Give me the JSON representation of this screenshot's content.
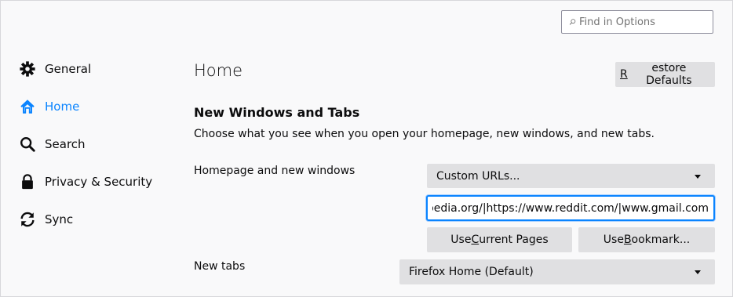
{
  "search": {
    "placeholder": "Find in Options"
  },
  "sidebar": {
    "items": [
      {
        "label": "General",
        "icon": "gear-icon"
      },
      {
        "label": "Home",
        "icon": "home-icon",
        "selected": true
      },
      {
        "label": "Search",
        "icon": "search-icon"
      },
      {
        "label": "Privacy & Security",
        "icon": "lock-icon"
      },
      {
        "label": "Sync",
        "icon": "sync-icon"
      }
    ]
  },
  "main": {
    "title": "Home",
    "restore_defaults": {
      "prefix": "R",
      "rest": "estore Defaults"
    },
    "section_title": "New Windows and Tabs",
    "section_desc": "Choose what you see when you open your homepage, new windows, and new tabs.",
    "homepage_label": "Homepage and new windows",
    "homepage_select": "Custom URLs...",
    "homepage_url": "pedia.org/|https://www.reddit.com/|www.gmail.com",
    "use_current_pages": {
      "pre": "Use ",
      "accel": "C",
      "post": "urrent Pages"
    },
    "use_bookmark": {
      "pre": "Use ",
      "accel": "B",
      "post": "ookmark..."
    },
    "newtabs_label": "New tabs",
    "newtabs_select": "Firefox Home (Default)"
  },
  "colors": {
    "accent": "#0a84ff",
    "button_bg": "#e0e0e2",
    "page_bg": "#f9f9fa"
  }
}
